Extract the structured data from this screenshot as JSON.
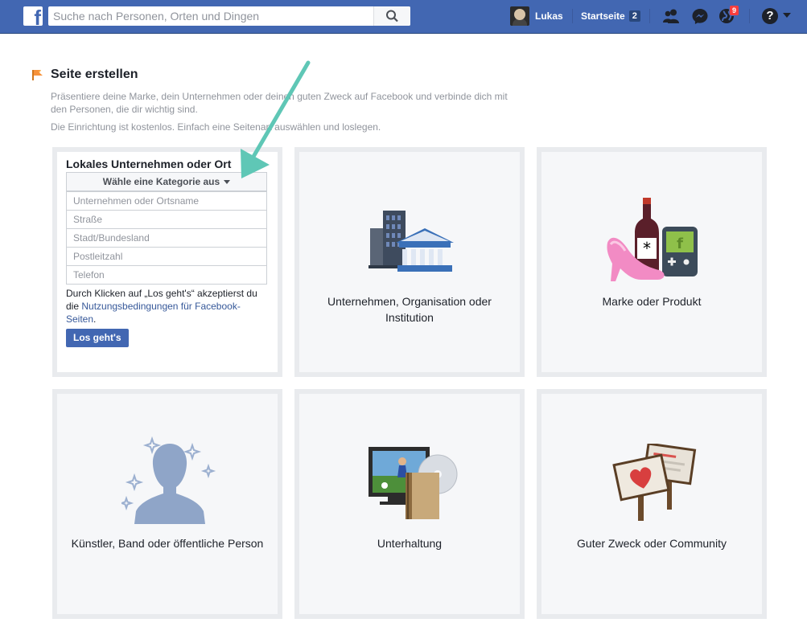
{
  "topbar": {
    "search_placeholder": "Suche nach Personen, Orten und Dingen",
    "user_name": "Lukas",
    "home_label": "Startseite",
    "home_count": "2",
    "notifications_count": "9",
    "help_label": "?"
  },
  "page": {
    "title": "Seite erstellen",
    "intro_1": "Präsentiere deine Marke, dein Unternehmen oder deinen guten Zweck auf Facebook und verbinde dich mit den Personen, die dir wichtig sind.",
    "intro_2": "Die Einrichtung ist kostenlos. Einfach eine Seitenart auswählen und loslegen."
  },
  "local_business": {
    "title": "Lokales Unternehmen oder Ort",
    "category_label": "Wähle eine Kategorie aus",
    "fields": {
      "name": "Unternehmen oder Ortsname",
      "street": "Straße",
      "city_state": "Stadt/Bundesland",
      "zip": "Postleitzahl",
      "phone": "Telefon"
    },
    "terms_prefix": "Durch Klicken auf „Los geht's“ akzeptierst du die ",
    "terms_link": "Nutzungsbedingungen für Facebook-Seiten",
    "terms_suffix": ".",
    "submit_label": "Los geht's"
  },
  "categories": [
    {
      "label": "Unternehmen, Organisation oder Institution"
    },
    {
      "label": "Marke oder Produkt"
    },
    {
      "label": "Künstler, Band oder öffentliche Person"
    },
    {
      "label": "Unterhaltung"
    },
    {
      "label": "Guter Zweck oder Community"
    }
  ],
  "colors": {
    "brand": "#4267b2",
    "annotation_arrow": "#5fc7b6"
  }
}
